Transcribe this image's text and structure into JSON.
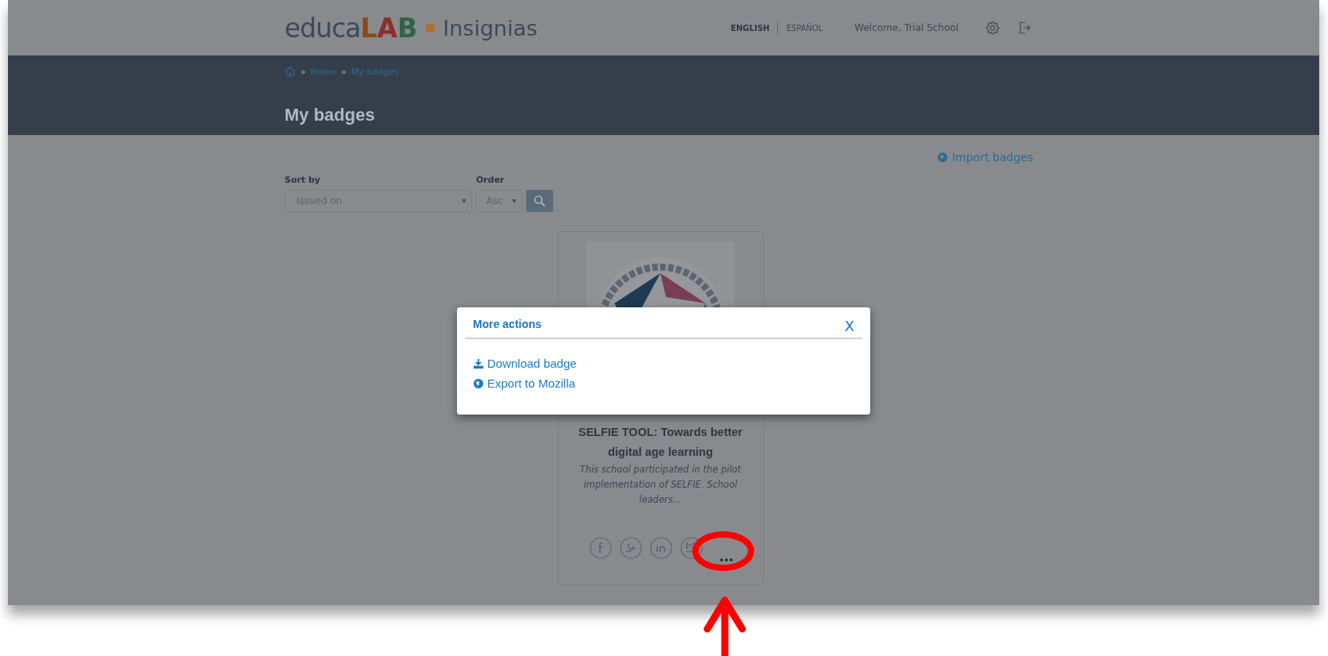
{
  "header": {
    "logo": {
      "part_1": "educa",
      "part_2": "LAB",
      "part_3": "Insignias"
    },
    "languages": [
      {
        "label": "ENGLISH",
        "selected": true
      },
      {
        "label": "ESPAÑOL",
        "selected": false
      }
    ],
    "welcome": "Welcome, Trial School"
  },
  "breadcrumb": [
    {
      "separator": "»",
      "label": "Home"
    },
    {
      "separator": "»",
      "label": "My badges"
    }
  ],
  "page_title": "My badges",
  "import_link": "Import badges",
  "filters": {
    "sort_by": {
      "label": "Sort by",
      "value": "Issued on"
    },
    "order": {
      "label": "Order",
      "value": "Asc"
    }
  },
  "badges": [
    {
      "title": "SELFIE TOOL: Towards better digital age learning",
      "description": "This school participated in the pilot implementation of SELFIE. School leaders..."
    }
  ],
  "modal": {
    "title": "More actions",
    "close": "X",
    "actions": [
      {
        "kind": "download",
        "label": "Download badge"
      },
      {
        "kind": "export",
        "label": "Export to Mozilla"
      }
    ]
  }
}
